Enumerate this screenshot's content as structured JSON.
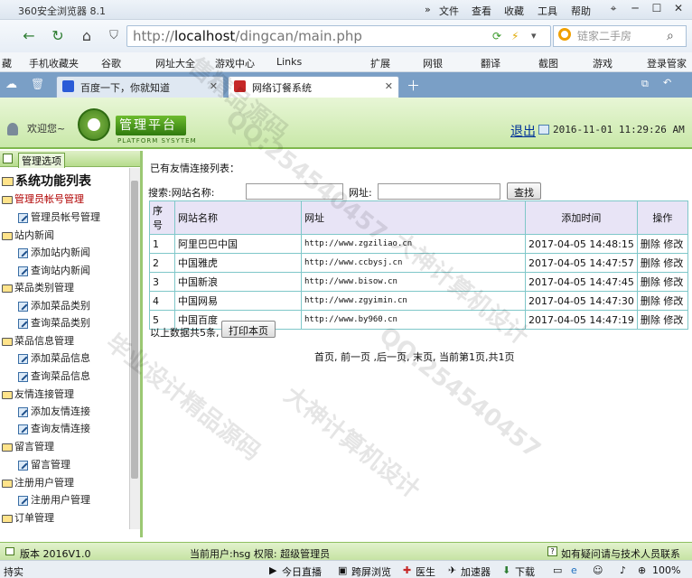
{
  "browser": {
    "title": "360安全浏览器 8.1",
    "menu": [
      "文件",
      "查看",
      "收藏",
      "工具",
      "帮助"
    ],
    "url_prefix": "http://",
    "url_host": "localhost",
    "url_path": "/dingcan/main.php",
    "search_placeholder": "链家二手房",
    "bookmarks": [
      "藏",
      "手机收藏夹",
      "谷歌",
      "网址大全",
      "游戏中心",
      "Links",
      "扩展",
      "网银",
      "翻译",
      "截图",
      "游戏",
      "登录管家"
    ],
    "tabs": [
      {
        "label": "百度一下，你就知道"
      },
      {
        "label": "网络订餐系统"
      }
    ]
  },
  "header": {
    "welcome": "欢迎您~",
    "platform_title": "管理平台",
    "platform_sub": "PLATFORM SYSYTEM",
    "logout": "退出",
    "datetime": "2016-11-01 11:29:26 AM"
  },
  "sidebar": {
    "tab_label": "管理选项",
    "root": "系统功能列表",
    "groups": [
      {
        "label": "管理员帐号管理",
        "items": [
          "管理员帐号管理"
        ]
      },
      {
        "label": "站内新闻",
        "items": [
          "添加站内新闻",
          "查询站内新闻"
        ]
      },
      {
        "label": "菜品类别管理",
        "items": [
          "添加菜品类别",
          "查询菜品类别"
        ]
      },
      {
        "label": "菜品信息管理",
        "items": [
          "添加菜品信息",
          "查询菜品信息"
        ]
      },
      {
        "label": "友情连接管理",
        "items": [
          "添加友情连接",
          "查询友情连接"
        ]
      },
      {
        "label": "留言管理",
        "items": [
          "留言管理"
        ]
      },
      {
        "label": "注册用户管理",
        "items": [
          "注册用户管理"
        ]
      },
      {
        "label": "订单管理",
        "items": []
      }
    ]
  },
  "main": {
    "list_title": "已有友情连接列表：",
    "search_label": "搜索:网站名称:",
    "url_label": "网址:",
    "search_button": "查找",
    "columns": [
      "序号",
      "网站名称",
      "网址",
      "添加时间",
      "操作"
    ],
    "rows": [
      {
        "no": "1",
        "name": "阿里巴巴中国",
        "url": "http://www.zgziliao.cn",
        "time": "2017-04-05 14:48:15",
        "del": "删除",
        "edit": "修改"
      },
      {
        "no": "2",
        "name": "中国雅虎",
        "url": "http://www.ccbysj.cn",
        "time": "2017-04-05 14:47:57",
        "del": "删除",
        "edit": "修改"
      },
      {
        "no": "3",
        "name": "中国新浪",
        "url": "http://www.bisow.cn",
        "time": "2017-04-05 14:47:45",
        "del": "删除",
        "edit": "修改"
      },
      {
        "no": "4",
        "name": "中国网易",
        "url": "http://www.zgyimin.cn",
        "time": "2017-04-05 14:47:30",
        "del": "删除",
        "edit": "修改"
      },
      {
        "no": "5",
        "name": "中国百度",
        "url": "http://www.by960.cn",
        "time": "2017-04-05 14:47:19",
        "del": "删除",
        "edit": "修改"
      }
    ],
    "summary": "以上数据共5条,",
    "print_button": "打印本页",
    "pager": "首页, 前一页 ,后一页, 末页, 当前第1页,共1页"
  },
  "status": {
    "version": "版本 2016V1.0",
    "user": "当前用户:hsg 权限: 超级管理员",
    "help": "如有疑问请与技术人员联系"
  },
  "bottom": {
    "left": "持实",
    "items": [
      "今日直播",
      "跨屏浏览",
      "医生",
      "加速器",
      "下载"
    ],
    "zoom": "100%"
  },
  "watermarks": [
    "大神计算机设计",
    "QQ:254540457",
    "毕业设计精品源码",
    "大神计算机设计",
    "QQ:254540457",
    "售精品源码"
  ]
}
